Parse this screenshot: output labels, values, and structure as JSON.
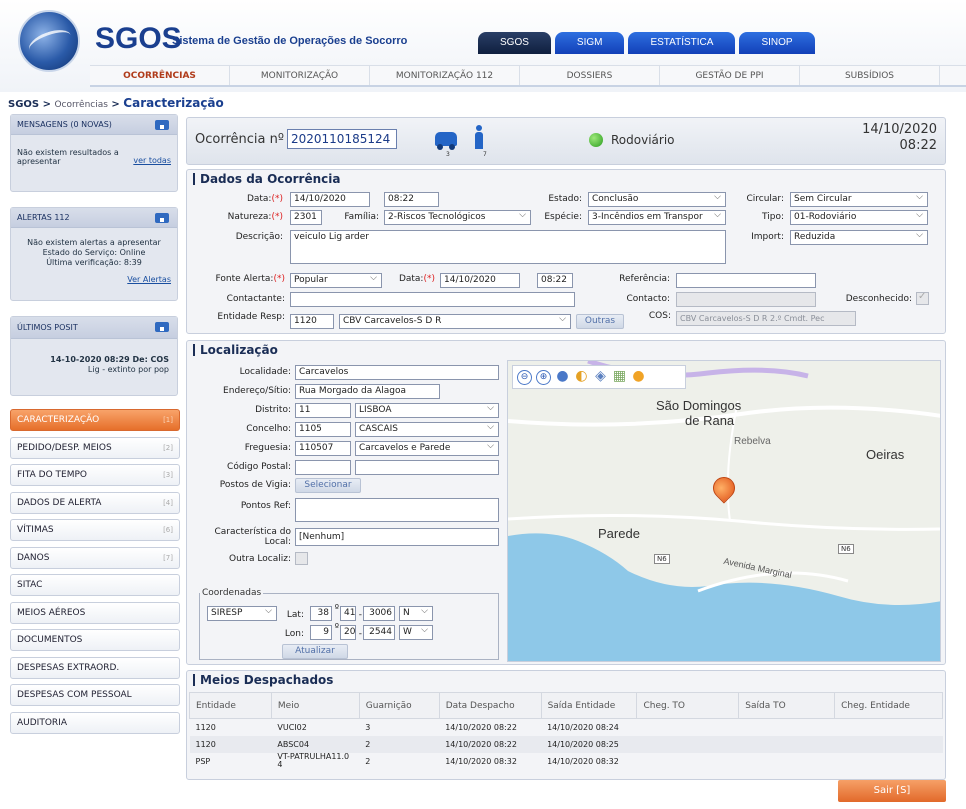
{
  "header": {
    "brand": "SGOS",
    "brand_sub": "Sistema de Gestão de Operações de Socorro",
    "top_tabs": [
      {
        "label": "SGOS",
        "style": "dark"
      },
      {
        "label": "SIGM",
        "style": "blue"
      },
      {
        "label": "ESTATÍSTICA",
        "style": "blue"
      },
      {
        "label": "SINOP",
        "style": "blue"
      }
    ],
    "nav": [
      {
        "label": "OCORRÊNCIAS",
        "active": true
      },
      {
        "label": "MONITORIZAÇÃO",
        "active": false
      },
      {
        "label": "MONITORIZAÇÃO 112",
        "active": false
      },
      {
        "label": "DOSSIERS",
        "active": false
      },
      {
        "label": "GESTÃO DE PPI",
        "active": false
      },
      {
        "label": "SUBSÍDIOS",
        "active": false
      }
    ]
  },
  "breadcrumb": {
    "root": "SGOS > ",
    "mid": "Ocorrências",
    "sep": " > ",
    "current": "Caracterização"
  },
  "sidebar": {
    "mensagens": {
      "title": "MENSAGENS (0 NOVAS)",
      "text": "Não existem resultados a apresentar",
      "link": "ver todas"
    },
    "alertas": {
      "title": "ALERTAS 112",
      "text": "Não existem alertas a apresentar",
      "estado": "Estado do Serviço: Online",
      "verificacao": "Última verificação: 8:39",
      "link": "Ver Alertas"
    },
    "posit": {
      "title": "ÚLTIMOS POSIT",
      "line1": "14-10-2020 08:29 De: COS",
      "line2": "Lig - extinto por pop"
    },
    "menu": [
      {
        "label": "CARACTERIZAÇÃO",
        "num": "[1]",
        "active": true
      },
      {
        "label": "PEDIDO/DESP. MEIOS",
        "num": "[2]",
        "active": false
      },
      {
        "label": "FITA DO TEMPO",
        "num": "[3]",
        "active": false
      },
      {
        "label": "DADOS DE ALERTA",
        "num": "[4]",
        "active": false
      },
      {
        "label": "VÍTIMAS",
        "num": "[6]",
        "active": false
      },
      {
        "label": "DANOS",
        "num": "[7]",
        "active": false
      },
      {
        "label": "SITAC",
        "num": "",
        "active": false
      },
      {
        "label": "MEIOS AÉREOS",
        "num": "",
        "active": false
      },
      {
        "label": "DOCUMENTOS",
        "num": "",
        "active": false
      },
      {
        "label": "DESPESAS EXTRAORD.",
        "num": "",
        "active": false
      },
      {
        "label": "DESPESAS COM PESSOAL",
        "num": "",
        "active": false
      },
      {
        "label": "AUDITORIA",
        "num": "",
        "active": false
      }
    ]
  },
  "occurrence": {
    "label": "Ocorrência nº",
    "number": "2020110185124",
    "vehicles": "3",
    "people": "7",
    "type": "Rodoviário",
    "date": "14/10/2020",
    "time": "08:22"
  },
  "dados": {
    "title": "Dados da Ocorrência",
    "data_label": "Data:",
    "req": "(*)",
    "data": "14/10/2020",
    "hora": "08:22",
    "estado_label": "Estado:",
    "estado": "Conclusão",
    "circular_label": "Circular:",
    "circular": "Sem Circular",
    "natureza_label": "Natureza:",
    "natureza": "2301",
    "familia_label": "Família:",
    "familia": "2-Riscos Tecnológicos",
    "especie_label": "Espécie:",
    "especie": "3-Incêndios em Transpor",
    "tipo_label": "Tipo:",
    "tipo": "01-Rodoviário",
    "descricao_label": "Descrição:",
    "descricao": "veiculo Lig arder",
    "import_label": "Import:",
    "import": "Reduzida",
    "fonte_label": "Fonte Alerta:",
    "fonte": "Popular",
    "data2_label": "Data:",
    "data2": "14/10/2020",
    "hora2": "08:22",
    "referencia_label": "Referência:",
    "referencia": "",
    "contactante_label": "Contactante:",
    "contactante": "",
    "contacto_label": "Contacto:",
    "contacto": "",
    "desconhecido_label": "Desconhecido:",
    "entidade_label": "Entidade Resp:",
    "entidade_cod": "1120",
    "entidade": "CBV Carcavelos-S D R",
    "outras": "Outras",
    "cos_label": "COS:",
    "cos": "CBV Carcavelos-S D R 2.º Cmdt. Pec"
  },
  "localizacao": {
    "title": "Localização",
    "localidade_label": "Localidade:",
    "localidade": "Carcavelos",
    "endereco_label": "Endereço/Sítio:",
    "endereco": "Rua Morgado da Alagoa",
    "distrito_label": "Distrito:",
    "distrito_cod": "11",
    "distrito": "LISBOA",
    "concelho_label": "Concelho:",
    "concelho_cod": "1105",
    "concelho": "CASCAIS",
    "freguesia_label": "Freguesia:",
    "freguesia_cod": "110507",
    "freguesia": "Carcavelos e Parede",
    "postal_label": "Código Postal:",
    "vigia_label": "Postos de Vigia:",
    "selecionar": "Selecionar",
    "pontos_label": "Pontos Ref:",
    "caracteristica_label1": "Característica do",
    "caracteristica_label2": "Local:",
    "caracteristica": "[Nenhum]",
    "outra_label": "Outra Localiz:",
    "coordenadas_label": "Coordenadas",
    "sistema": "SIRESP",
    "lat_label": "Lat:",
    "lat_deg": "38",
    "lat_min": "41",
    "lat_sec": "3006",
    "lat_dir": "N",
    "lon_label": "Lon:",
    "lon_deg": "9",
    "lon_min": "20",
    "lon_sec": "2544",
    "lon_dir": "W",
    "deg_sym": "º",
    "dash": "-",
    "atualizar": "Atualizar"
  },
  "map": {
    "labels": [
      {
        "text": "São Domingos"
      },
      {
        "text": "de Rana"
      },
      {
        "text": "Rebelva"
      },
      {
        "text": "Oeiras"
      },
      {
        "text": "Parede"
      },
      {
        "text": "Avenida Marginal"
      }
    ],
    "roads": [
      "N6",
      "N6"
    ],
    "toolbar": [
      "⊖",
      "⊕",
      "●",
      "◐",
      "◈",
      "▦",
      "●"
    ]
  },
  "meios": {
    "title": "Meios Despachados",
    "columns": [
      "Entidade",
      "Meio",
      "Guarnição",
      "Data Despacho",
      "Saída Entidade",
      "Cheg. TO",
      "Saída TO",
      "Cheg. Entidade"
    ],
    "rows": [
      [
        "1120",
        "VUCI02",
        "3",
        "14/10/2020 08:22",
        "14/10/2020 08:24",
        "",
        "",
        ""
      ],
      [
        "1120",
        "ABSC04",
        "2",
        "14/10/2020 08:22",
        "14/10/2020 08:25",
        "",
        "",
        ""
      ],
      [
        "PSP",
        "VT-PATRULHA11.04",
        "2",
        "14/10/2020 08:32",
        "14/10/2020 08:32",
        "",
        "",
        ""
      ]
    ]
  },
  "sair": "Sair [S]"
}
